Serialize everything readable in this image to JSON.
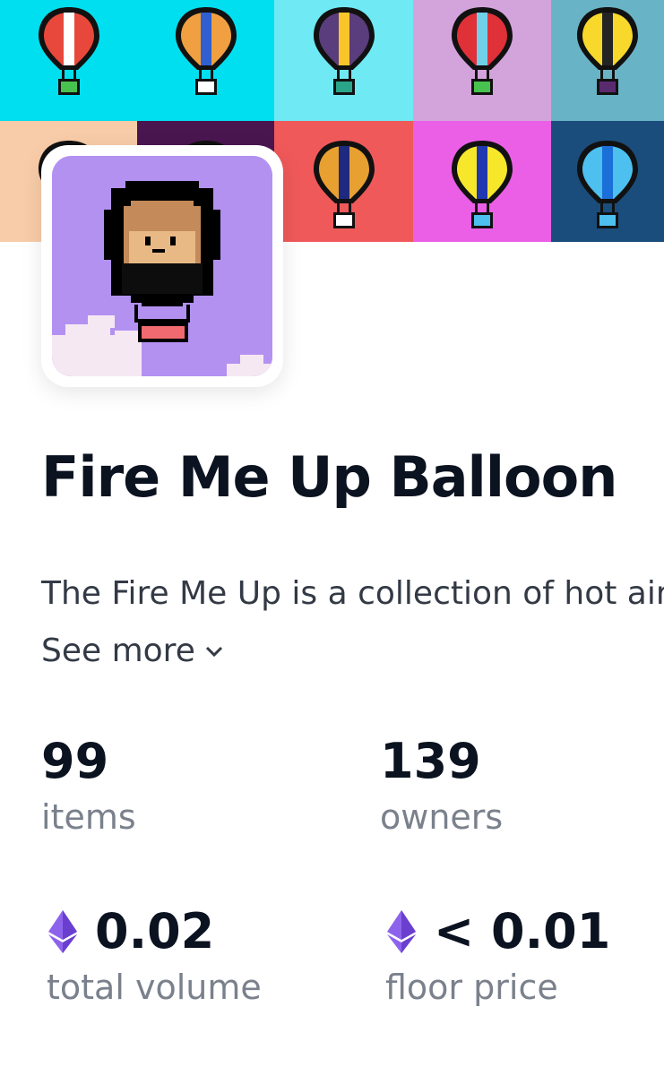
{
  "collection": {
    "title": "Fire Me Up Balloon",
    "description": "The Fire Me Up is a collection of hot air balloons",
    "see_more_label": "See more"
  },
  "stats": {
    "items_value": "99",
    "items_label": "items",
    "owners_value": "139",
    "owners_label": "owners",
    "volume_value": "0.02",
    "volume_label": "total volume",
    "floor_value": "< 0.01",
    "floor_label": "floor price"
  },
  "icons": {
    "currency": "ethereum-icon",
    "expand": "chevron-down-icon",
    "banner": "hot-air-balloon-icon",
    "avatar": "monkey-balloon-avatar"
  },
  "colors": {
    "banner_row1": [
      "#00dff0",
      "#00dff0",
      "#6fe9f3",
      "#d3a3db",
      "#68b4c6"
    ],
    "banner_row2": [
      "#f8cca8",
      "#4a1650",
      "#f0595a",
      "#eb5fe6",
      "#1a4d7c"
    ],
    "avatar_bg": "#b391f1",
    "ethereum": "#7a4de0",
    "title_text": "#0b1220",
    "muted_text": "#7a818c"
  }
}
